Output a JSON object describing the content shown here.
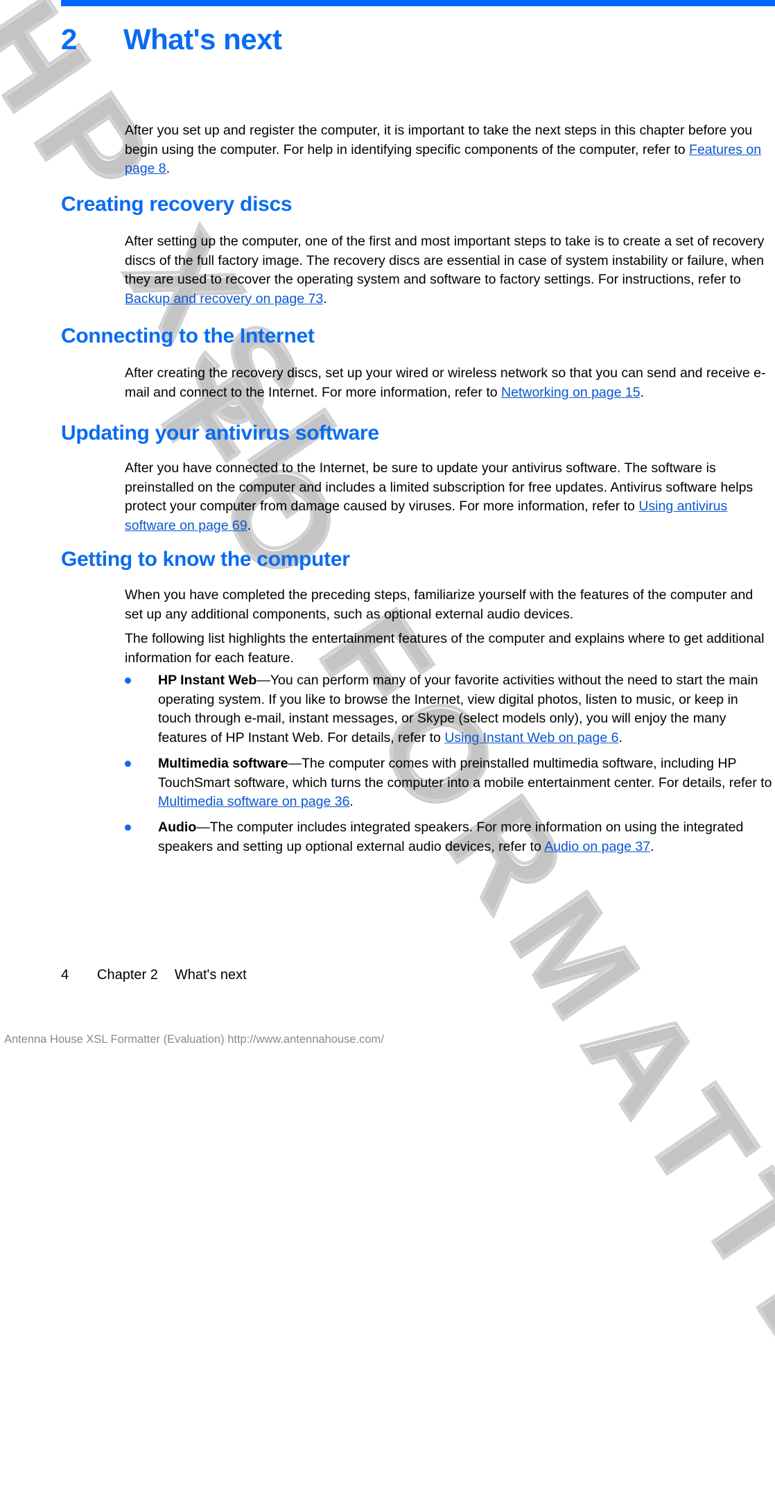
{
  "page": {
    "rule_color": "#0066ff",
    "heading_color": "#0a6cf0",
    "link_color": "#0a57d0"
  },
  "watermark": {
    "line1": "HP XSL",
    "line2": "FO FORMATTER",
    "full_text": "HP XSL FO FORMATTER EVALUATION"
  },
  "chapter": {
    "number": "2",
    "title": "What's next"
  },
  "intro": {
    "text_before_link": "After you set up and register the computer, it is important to take the next steps in this chapter before you begin using the computer. For help in identifying specific components of the computer, refer to ",
    "link": "Features on page 8",
    "text_after_link": "."
  },
  "sections": [
    {
      "heading": "Creating recovery discs",
      "text_before_link": "After setting up the computer, one of the first and most important steps to take is to create a set of recovery discs of the full factory image. The recovery discs are essential in case of system instability or failure, when they are used to recover the operating system and software to factory settings. For instructions, refer to ",
      "link": "Backup and recovery on page 73",
      "text_after_link": "."
    },
    {
      "heading": "Connecting to the Internet",
      "text_before_link": "After creating the recovery discs, set up your wired or wireless network so that you can send and receive e-mail and connect to the Internet. For more information, refer to ",
      "link": "Networking on page 15",
      "text_after_link": "."
    },
    {
      "heading": "Updating your antivirus software",
      "text_before_link": "After you have connected to the Internet, be sure to update your antivirus software. The software is preinstalled on the computer and includes a limited subscription for free updates. Antivirus software helps protect your computer from damage caused by viruses. For more information, refer to ",
      "link": "Using antivirus software on page 69",
      "text_after_link": "."
    }
  ],
  "getting_to_know": {
    "heading": "Getting to know the computer",
    "para1": "When you have completed the preceding steps, familiarize yourself with the features of the computer and set up any additional components, such as optional external audio devices.",
    "para2": "The following list highlights the entertainment features of the computer and explains where to get additional information for each feature.",
    "bullets": [
      {
        "term": "HP Instant Web",
        "text_before_link": "—You can perform many of your favorite activities without the need to start the main operating system. If you like to browse the Internet, view digital photos, listen to music, or keep in touch through e-mail, instant messages, or Skype (select models only), you will enjoy the many features of HP Instant Web. For details, refer to ",
        "link": "Using Instant Web on page 6",
        "text_after_link": "."
      },
      {
        "term": "Multimedia software",
        "text_before_link": "—The computer comes with preinstalled multimedia software, including HP TouchSmart software, which turns the computer into a mobile entertainment center. For details, refer to ",
        "link": "Multimedia software on page 36",
        "text_after_link": "."
      },
      {
        "term": "Audio",
        "text_before_link": "—The computer includes integrated speakers. For more information on using the integrated speakers and setting up optional external audio devices, refer to ",
        "link": "Audio on page 37",
        "text_after_link": "."
      }
    ]
  },
  "footer": {
    "page_number": "4",
    "chapter_label": "Chapter 2",
    "chapter_title": "What's next"
  },
  "evaluation_notice": "Antenna House XSL Formatter (Evaluation)  http://www.antennahouse.com/"
}
